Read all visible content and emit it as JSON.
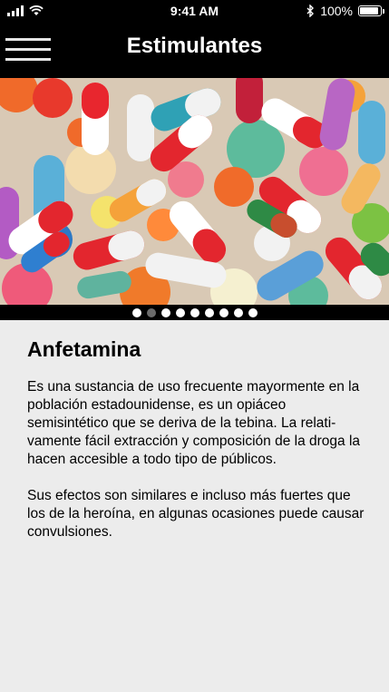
{
  "status_bar": {
    "time": "9:41 AM",
    "battery": "100%"
  },
  "nav": {
    "title": "Estimulantes",
    "menu_icon": "hamburger-icon"
  },
  "carousel": {
    "page_count": 9,
    "active_index": 1
  },
  "article": {
    "title": "Anfetamina",
    "paragraph1": "Es una sustancia de uso frecuente mayormente en la población estadounidense, es un opiáceo semisintético que se deriva de la tebina. La relati-vamente fácil extracción y composición de la droga la hacen accesible a todo tipo de públicos.",
    "paragraph2": "Sus efectos son similares e incluso más fuertes que los de la heroína, en algunas ocasiones puede causar convulsiones."
  },
  "colors": {
    "bar": "#000000",
    "background": "#ececec",
    "pager_active": "#6b6b6b"
  }
}
